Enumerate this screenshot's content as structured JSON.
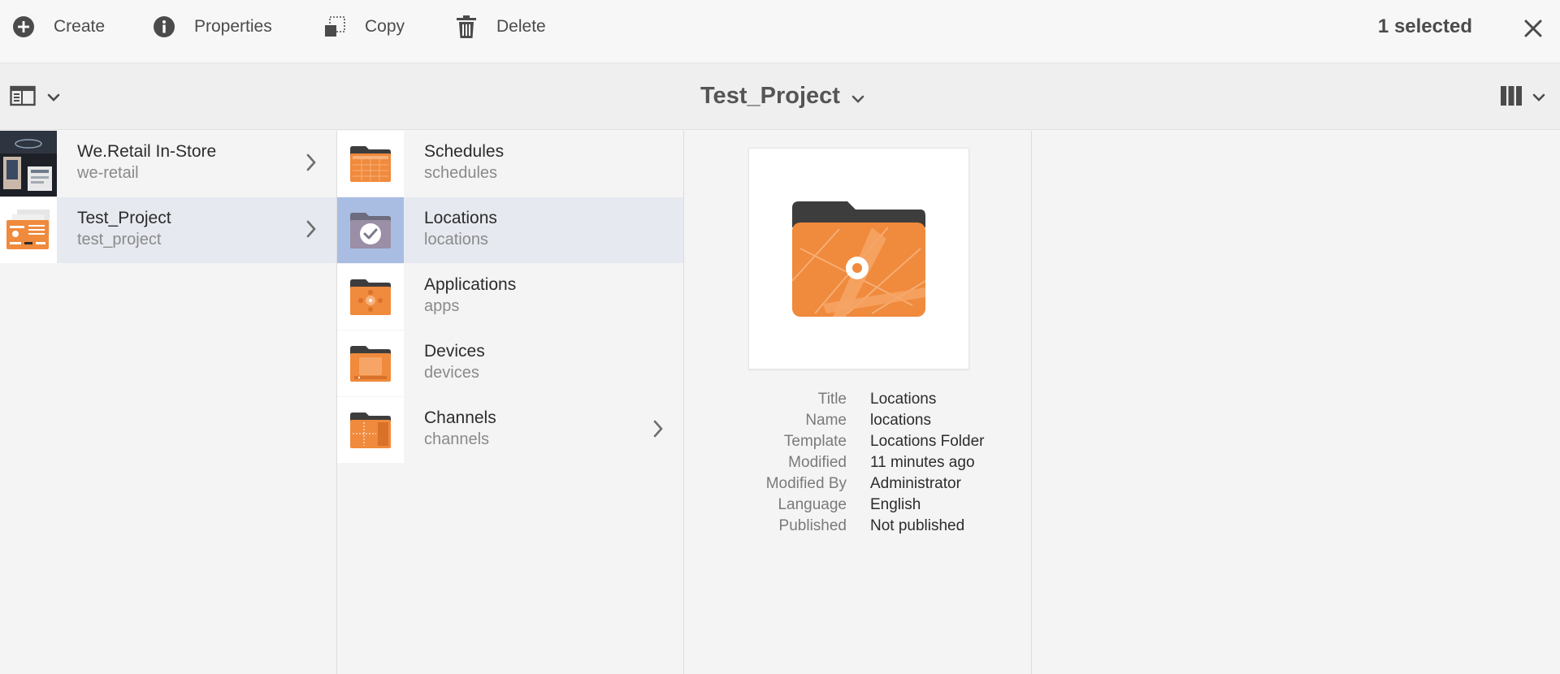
{
  "actionbar": {
    "create": "Create",
    "properties": "Properties",
    "copy": "Copy",
    "delete": "Delete",
    "selection_count": "1 selected"
  },
  "titlebar": {
    "title": "Test_Project",
    "rail_icon": "rail-toggle-icon",
    "view_icon": "column-view-icon"
  },
  "column1": {
    "items": [
      {
        "title": "We.Retail In-Store",
        "name": "we-retail",
        "has_children": true
      },
      {
        "title": "Test_Project",
        "name": "test_project",
        "has_children": true,
        "selected": true
      }
    ]
  },
  "column2": {
    "items": [
      {
        "title": "Schedules",
        "name": "schedules"
      },
      {
        "title": "Locations",
        "name": "locations",
        "selected": true
      },
      {
        "title": "Applications",
        "name": "apps"
      },
      {
        "title": "Devices",
        "name": "devices"
      },
      {
        "title": "Channels",
        "name": "channels",
        "has_children": true
      }
    ]
  },
  "preview": {
    "labels": {
      "title": "Title",
      "name": "Name",
      "template": "Template",
      "modified": "Modified",
      "modified_by": "Modified By",
      "language": "Language",
      "published": "Published"
    },
    "values": {
      "title": "Locations",
      "name": "locations",
      "template": "Locations Folder",
      "modified": "11 minutes ago",
      "modified_by": "Administrator",
      "language": "English",
      "published": "Not published"
    }
  },
  "colors": {
    "accent_orange": "#f08a3c",
    "folder_dark": "#3d3d3d",
    "selection_bg": "#e6e9ef",
    "selection_thumb": "#a9bde3"
  }
}
